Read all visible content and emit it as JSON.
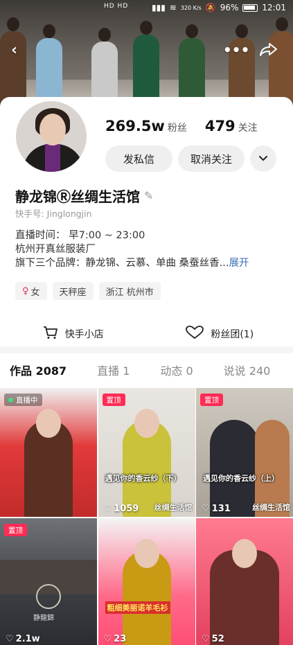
{
  "status_bar": {
    "left_text": "HD HD",
    "net_speed": "320 K/s",
    "battery": "96%",
    "time": "12:01"
  },
  "banner": {
    "back_icon": "chevron-left-icon",
    "more_icon": "more-dots-icon",
    "share_icon": "share-arrow-icon"
  },
  "profile": {
    "followers_num": "269.5w",
    "followers_label": "粉丝",
    "following_num": "479",
    "following_label": "关注",
    "message_label": "发私信",
    "unfollow_label": "取消关注",
    "name": "静龙锦Ⓡ丝绸生活馆",
    "uid": "快手号: Jinglongjin",
    "bio_line1": "直播时间：  早7:00 ~ 23:00",
    "bio_line2": "杭州开真丝服装厂",
    "bio_line3": "旗下三个品牌：静龙锦、云慕、单曲 桑蚕丝香...",
    "bio_more": "展开",
    "tag_gender": "女",
    "tag_zodiac": "天秤座",
    "tag_location": "浙江 杭州市",
    "shop_label": "快手小店",
    "fans_label": "粉丝团(1)"
  },
  "tabs": [
    {
      "label": "作品 2087",
      "active": true
    },
    {
      "label": "直播 1",
      "active": false
    },
    {
      "label": "动态 0",
      "active": false
    },
    {
      "label": "说说 240",
      "active": false
    }
  ],
  "grid": {
    "items": [
      {
        "badge": "直播中",
        "likes": "",
        "caption": "",
        "watermark": ""
      },
      {
        "badge": "置顶",
        "likes": "1059",
        "caption": "遇见你的香云纱（下）",
        "watermark": "丝绸生活馆"
      },
      {
        "badge": "置顶",
        "likes": "131",
        "caption": "遇见你的香云纱（上）",
        "watermark": "丝绸生活馆"
      },
      {
        "badge": "置顶",
        "likes": "2.1w",
        "caption": "",
        "watermark": "静龍錦"
      },
      {
        "badge": "",
        "likes": "23",
        "caption": "粗细美丽诺羊毛衫",
        "watermark": ""
      },
      {
        "badge": "",
        "likes": "52",
        "caption": "",
        "watermark": ""
      }
    ]
  },
  "colors": {
    "accent": "#ff2c55",
    "link": "#3b6fb6"
  }
}
